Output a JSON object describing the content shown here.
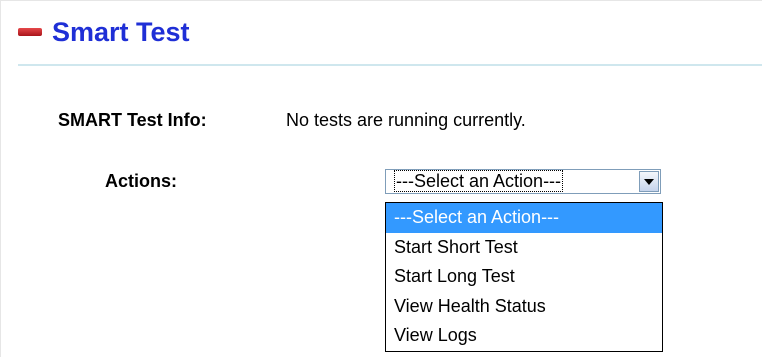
{
  "section": {
    "title": "Smart Test",
    "collapse_icon": "collapse-minus-icon"
  },
  "info": {
    "label": "SMART Test Info:",
    "value": "No tests are running currently."
  },
  "actions": {
    "label": "Actions:",
    "selected": "---Select an Action---",
    "options": [
      "---Select an Action---",
      "Start Short Test",
      "Start Long Test",
      "View Health Status",
      "View Logs"
    ],
    "highlighted_index": 0,
    "dropdown_open": true
  },
  "colors": {
    "title": "#1f2fd6",
    "icon": "#c8262c",
    "divider": "#cfe7ee",
    "highlight": "#3399ff"
  }
}
